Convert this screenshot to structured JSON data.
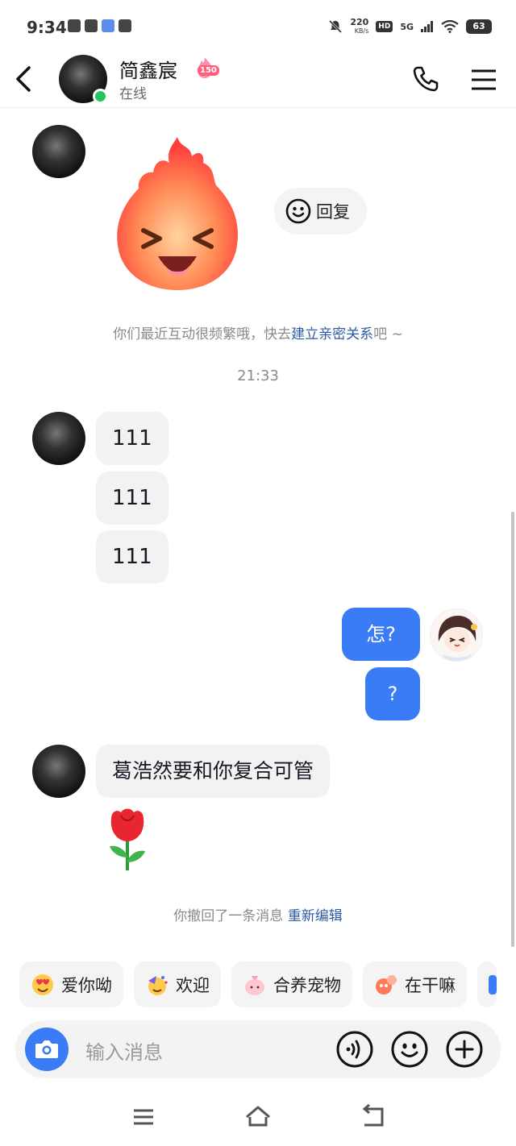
{
  "status_bar": {
    "time": "9:34",
    "net_speed_value": "220",
    "net_speed_unit": "KB/s",
    "hd_label": "HD",
    "network": "5G",
    "battery": "63"
  },
  "header": {
    "contact_name": "简鑫宸",
    "fire_count": "150",
    "presence": "在线"
  },
  "messages": {
    "reply_label": "回复",
    "hint_prefix": "你们最近互动很频繁哦，快去",
    "hint_link": "建立亲密关系",
    "hint_suffix": "吧 ~",
    "time_divider": "21:33",
    "incoming_1": "111",
    "incoming_2": "111",
    "incoming_3": "111",
    "outgoing_1": "怎?",
    "outgoing_2": "?",
    "incoming_4": "葛浩然要和你复合可管",
    "recall_text": "你撤回了一条消息",
    "recall_edit": "重新编辑"
  },
  "quick_replies": [
    "爱你呦",
    "欢迎",
    "合养宠物",
    "在干嘛"
  ],
  "input": {
    "placeholder": "输入消息"
  },
  "colors": {
    "accent": "#3a7cf5",
    "online": "#22c55e",
    "link": "#2b5aa6"
  }
}
